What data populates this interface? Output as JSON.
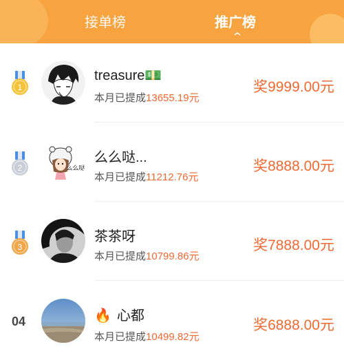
{
  "tabs": [
    {
      "label": "接单榜",
      "active": false
    },
    {
      "label": "推广榜",
      "active": true
    }
  ],
  "colors": {
    "header": "#f7a33f",
    "accent": "#ee6a33",
    "medal_gold": "#f5c33b",
    "medal_silver": "#c9ced6",
    "medal_bronze": "#f0a64a",
    "ribbon": "#4a90e2"
  },
  "withdraw_label": "本月已提成",
  "leaderboard": [
    {
      "rank": "1",
      "name": "treasure",
      "name_emoji": "💵",
      "withdrawn": "13655.19元",
      "prize": "奖9999.00元",
      "avatar_icon": "anime-boy-avatar"
    },
    {
      "rank": "2",
      "name": "么么哒...",
      "withdrawn": "11212.76元",
      "prize": "奖8888.00元",
      "avatar_icon": "cartoon-girl-avatar"
    },
    {
      "rank": "3",
      "name": "茶茶呀",
      "withdrawn": "10799.86元",
      "prize": "奖7888.00元",
      "avatar_icon": "portrait-avatar"
    },
    {
      "rank": "04",
      "name": "心都",
      "name_emoji": "🔥",
      "withdrawn": "10499.82元",
      "prize": "奖6888.00元",
      "avatar_icon": "beach-avatar"
    }
  ]
}
